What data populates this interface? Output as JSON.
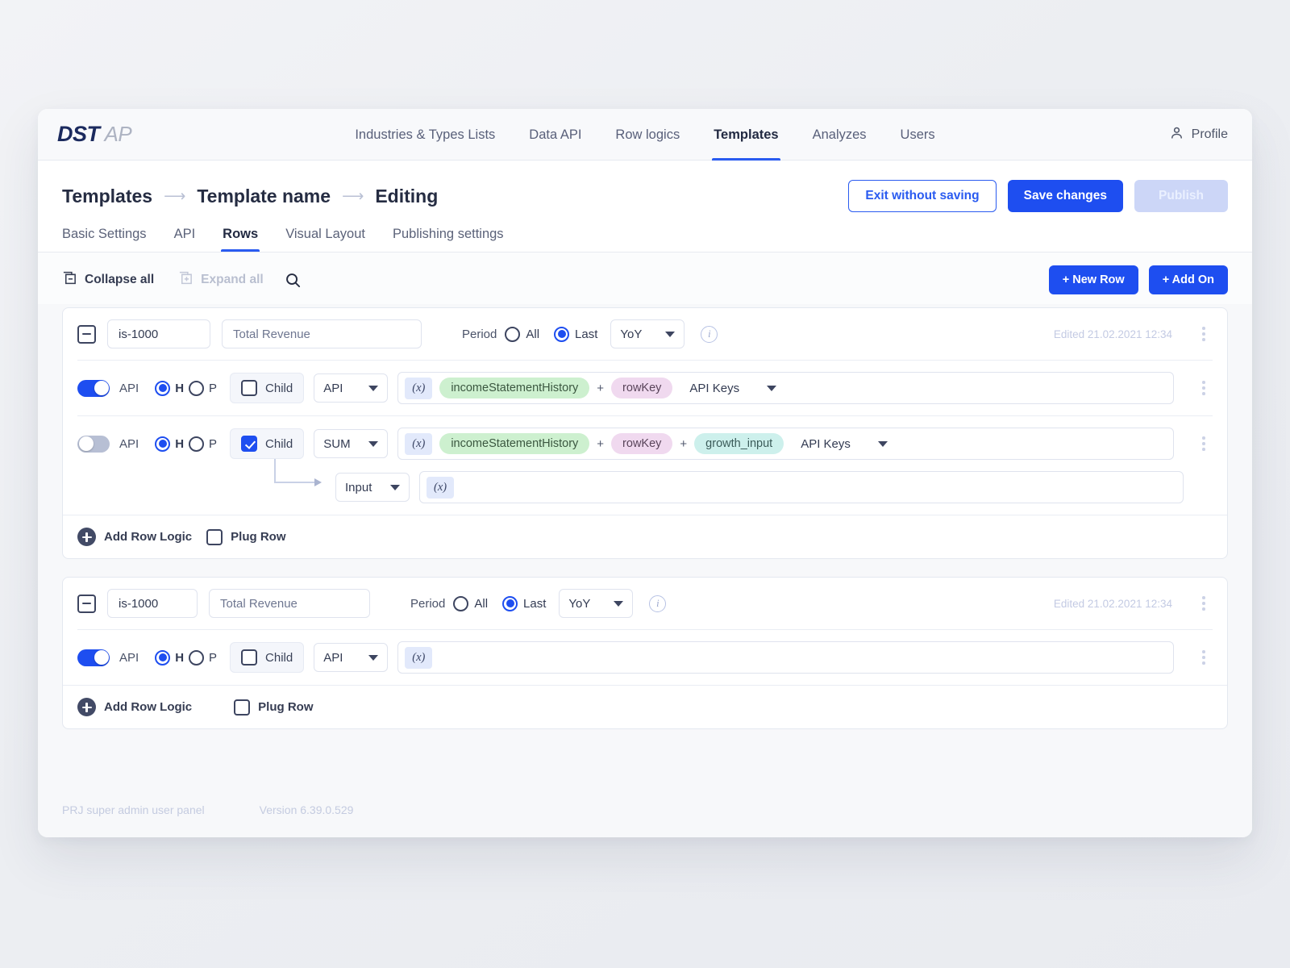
{
  "brand": {
    "name_bold": "DST",
    "name_light": "AP"
  },
  "topnav": {
    "items": [
      {
        "label": "Industries & Types Lists",
        "active": false
      },
      {
        "label": "Data API",
        "active": false
      },
      {
        "label": "Row logics",
        "active": false
      },
      {
        "label": "Templates",
        "active": true
      },
      {
        "label": "Analyzes",
        "active": false
      },
      {
        "label": "Users",
        "active": false
      }
    ],
    "profile_label": "Profile",
    "profile_icon": "user-icon"
  },
  "header": {
    "breadcrumb": [
      "Templates",
      "Template name",
      "Editing"
    ],
    "breadcrumb_separator": "⟶",
    "exit_label": "Exit without saving",
    "save_label": "Save changes",
    "publish_label": "Publish"
  },
  "subtabs": [
    {
      "label": "Basic Settings",
      "active": false
    },
    {
      "label": "API",
      "active": false
    },
    {
      "label": "Rows",
      "active": true
    },
    {
      "label": "Visual Layout",
      "active": false
    },
    {
      "label": "Publishing settings",
      "active": false
    }
  ],
  "toolbar": {
    "collapse_all": "Collapse all",
    "expand_all": "Expand all",
    "search_icon": "search-icon",
    "new_row": "+ New Row",
    "add_on": "+ Add On"
  },
  "colors": {
    "accent_blue": "#1e4ef0",
    "nav_active": "#2a5bf0",
    "chip_green": "#cdf0cf",
    "chip_pink": "#f0d9ef",
    "chip_teal": "#cdf0ec",
    "fx_bg": "#e2e9fb",
    "disabled_btn": "#ccd6f7"
  },
  "cards": [
    {
      "code": "is-1000",
      "title": "Total Revenue",
      "period_label": "Period",
      "period_all": "All",
      "period_last": "Last",
      "period_selected": "Last",
      "frequency": "YoY",
      "info_icon": "info-icon",
      "edited": "Edited 21.02.2021 12:34",
      "logic_rows": [
        {
          "api_label": "API",
          "api_on": true,
          "h_label": "H",
          "p_label": "P",
          "hp_selected": "H",
          "child_label": "Child",
          "child_checked": false,
          "operation": "API",
          "fx": "(x)",
          "tokens": [
            {
              "kind": "chip-green",
              "text": "incomeStatementHistory"
            },
            {
              "kind": "op",
              "text": "+"
            },
            {
              "kind": "chip-pink",
              "text": "rowKey"
            }
          ],
          "keys_select": "API Keys",
          "has_child_input": false
        },
        {
          "api_label": "API",
          "api_on": false,
          "h_label": "H",
          "p_label": "P",
          "hp_selected": "H",
          "child_label": "Child",
          "child_checked": true,
          "operation": "SUM",
          "fx": "(x)",
          "tokens": [
            {
              "kind": "chip-green",
              "text": "incomeStatementHistory"
            },
            {
              "kind": "op",
              "text": "+"
            },
            {
              "kind": "chip-pink",
              "text": "rowKey"
            },
            {
              "kind": "op",
              "text": "+"
            },
            {
              "kind": "chip-teal",
              "text": "growth_input"
            }
          ],
          "keys_select": "API Keys",
          "has_child_input": true,
          "child_input_select": "Input",
          "child_input_fx": "(x)"
        }
      ],
      "add_row_logic": "Add Row Logic",
      "plug_row": "Plug Row",
      "plug_checked": false
    },
    {
      "code": "is-1000",
      "title": "Total Revenue",
      "period_label": "Period",
      "period_all": "All",
      "period_last": "Last",
      "period_selected": "Last",
      "frequency": "YoY",
      "info_icon": "info-icon",
      "edited": "Edited 21.02.2021 12:34",
      "logic_rows": [
        {
          "api_label": "API",
          "api_on": true,
          "h_label": "H",
          "p_label": "P",
          "hp_selected": "H",
          "child_label": "Child",
          "child_checked": false,
          "operation": "API",
          "fx": "(x)",
          "tokens": [],
          "keys_select": "",
          "has_child_input": false
        }
      ],
      "add_row_logic": "Add Row Logic",
      "plug_row": "Plug Row",
      "plug_checked": false
    }
  ],
  "footer": {
    "left": "PRJ super admin user panel",
    "right": "Version 6.39.0.529"
  }
}
